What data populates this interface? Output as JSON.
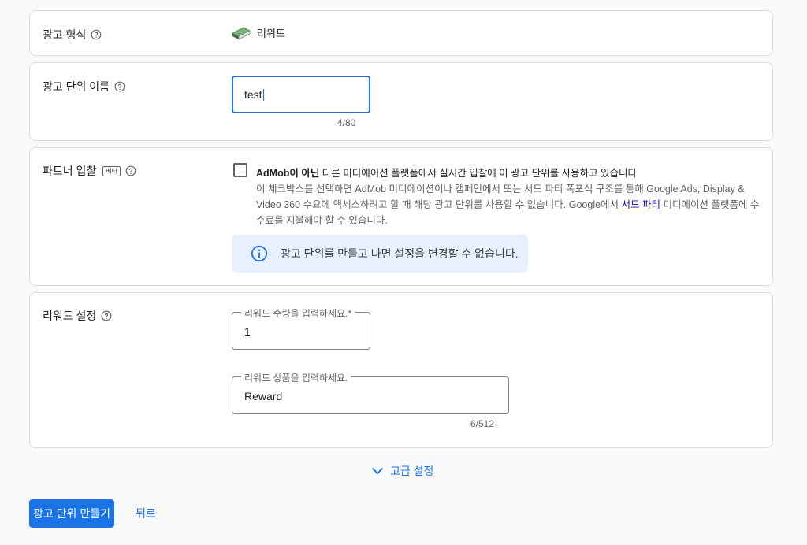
{
  "format_card": {
    "label": "광고 형식",
    "value": "리워드",
    "value_icon": "reward-book-icon"
  },
  "name_card": {
    "label": "광고 단위 이름",
    "input_value": "test",
    "counter": "4/80"
  },
  "partner_card": {
    "label": "파트너 입찰",
    "beta_badge": "베타",
    "checkbox_checked": false,
    "checkbox_title_bold": "AdMob이 아닌",
    "checkbox_title_rest": " 다른 미디에이션 플랫폼에서 실시간 입찰에 이 광고 단위를 사용하고 있습니다",
    "desc_before_link": "이 체크박스를 선택하면 AdMob 미디에이션이나 캠페인에서 또는 서드 파티 폭포식 구조를 통해 Google Ads, Display & Video 360 수요에 액세스하려고 할 때 해당 광고 단위를 사용할 수 없습니다. Google에서 ",
    "desc_link": "서드 파티",
    "desc_after_link": " 미디에이션 플랫폼에 수수료를 지불해야 할 수 있습니다.",
    "info_text": "광고 단위를 만들고 나면 설정을 변경할 수 없습니다."
  },
  "reward_card": {
    "label": "리워드 설정",
    "amount_label": "리워드 수량을 입력하세요.*",
    "amount_value": "1",
    "item_label": "리워드 상품을 입력하세요.",
    "item_value": "Reward",
    "item_counter": "6/512"
  },
  "advanced": {
    "label": "고급 설정"
  },
  "actions": {
    "create_label": "광고 단위 만들기",
    "back_label": "뒤로"
  },
  "colors": {
    "accent": "#1a73e8",
    "info_bg": "#e8f0fe",
    "card_border": "#dadce0"
  }
}
